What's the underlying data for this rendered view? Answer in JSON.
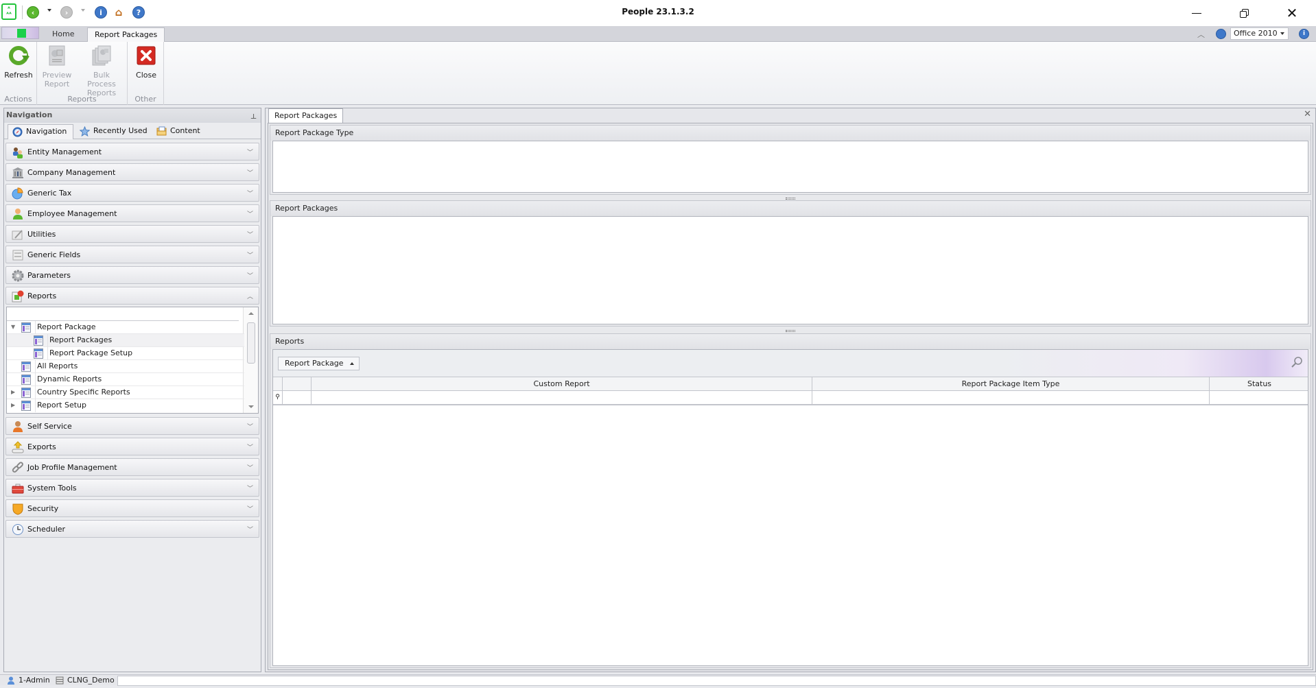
{
  "window": {
    "title": "People 23.1.3.2",
    "controls": [
      "minimize",
      "restore",
      "close"
    ]
  },
  "quick_access": {
    "icons": [
      "app-logo-icon",
      "back-icon",
      "forward-icon",
      "info-icon",
      "home-icon",
      "help-icon"
    ]
  },
  "ribbon": {
    "tabs": [
      {
        "label": "Home",
        "active": false
      },
      {
        "label": "Report Packages",
        "active": true
      }
    ],
    "theme_select": {
      "value": "Office 2010"
    },
    "groups": [
      {
        "label": "Actions",
        "buttons": [
          {
            "label": "Refresh",
            "icon": "refresh-icon",
            "enabled": true
          }
        ]
      },
      {
        "label": "Reports",
        "buttons": [
          {
            "label_line1": "Preview",
            "label_line2": "Report",
            "icon": "preview-report-icon",
            "enabled": false
          },
          {
            "label_line1": "Bulk Process",
            "label_line2": "Reports",
            "icon": "bulk-process-icon",
            "enabled": false
          }
        ]
      },
      {
        "label": "Other",
        "buttons": [
          {
            "label": "Close",
            "icon": "close-icon",
            "enabled": true
          }
        ]
      }
    ]
  },
  "navigation": {
    "title": "Navigation",
    "tabs": [
      {
        "label": "Navigation",
        "icon": "compass-icon",
        "active": true
      },
      {
        "label": "Recently Used",
        "icon": "star-icon",
        "active": false
      },
      {
        "label": "Content",
        "icon": "folder-icon",
        "active": false
      }
    ],
    "groups": [
      {
        "label": "Entity Management",
        "icon": "users-icon",
        "expanded": false
      },
      {
        "label": "Company Management",
        "icon": "building-icon",
        "expanded": false
      },
      {
        "label": "Generic Tax",
        "icon": "pie-chart-icon",
        "expanded": false
      },
      {
        "label": "Employee Management",
        "icon": "person-icon",
        "expanded": false
      },
      {
        "label": "Utilities",
        "icon": "tools-icon",
        "expanded": false
      },
      {
        "label": "Generic Fields",
        "icon": "fields-icon",
        "expanded": false
      },
      {
        "label": "Parameters",
        "icon": "gear-icon",
        "expanded": false
      },
      {
        "label": "Reports",
        "icon": "report-icon",
        "expanded": true
      },
      {
        "label": "Self Service",
        "icon": "self-service-icon",
        "expanded": false
      },
      {
        "label": "Exports",
        "icon": "export-icon",
        "expanded": false
      },
      {
        "label": "Job Profile Management",
        "icon": "chain-icon",
        "expanded": false
      },
      {
        "label": "System Tools",
        "icon": "toolbox-icon",
        "expanded": false
      },
      {
        "label": "Security",
        "icon": "shield-icon",
        "expanded": false
      },
      {
        "label": "Scheduler",
        "icon": "clock-icon",
        "expanded": false
      }
    ],
    "reports_tree": [
      {
        "label": "Report Package",
        "level": 0,
        "expander": "expanded",
        "selected": false
      },
      {
        "label": "Report Packages",
        "level": 1,
        "expander": "none",
        "selected": true
      },
      {
        "label": "Report Package Setup",
        "level": 1,
        "expander": "none",
        "selected": false
      },
      {
        "label": "All Reports",
        "level": 0,
        "expander": "none",
        "selected": false
      },
      {
        "label": "Dynamic Reports",
        "level": 0,
        "expander": "none",
        "selected": false
      },
      {
        "label": "Country Specific Reports",
        "level": 0,
        "expander": "collapsed",
        "selected": false
      },
      {
        "label": "Report Setup",
        "level": 0,
        "expander": "collapsed",
        "selected": false
      }
    ]
  },
  "document": {
    "tab_label": "Report Packages",
    "sections": {
      "type": {
        "title": "Report Package Type"
      },
      "packages": {
        "title": "Report Packages"
      },
      "reports": {
        "title": "Reports",
        "group_by_chip": "Report Package",
        "columns": [
          "Custom Report",
          "Report Package Item Type",
          "Status"
        ],
        "rows": []
      }
    }
  },
  "statusbar": {
    "user": "1-Admin",
    "database": "CLNG_Demo"
  }
}
